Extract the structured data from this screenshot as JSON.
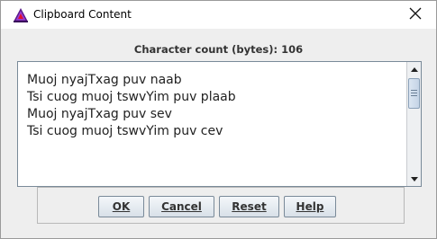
{
  "window": {
    "title": "Clipboard Content"
  },
  "header": {
    "count_label": "Character count (bytes): 106"
  },
  "content": {
    "lines": [
      "Muoj nyajTxag puv naab",
      "Tsi cuog muoj tswvYim puv plaab",
      "Muoj nyajTxag puv sev",
      "Tsi cuog muoj tswvYim puv cev"
    ]
  },
  "buttons": {
    "ok": "OK",
    "cancel": "Cancel",
    "reset": "Reset",
    "help": "Help"
  },
  "icons": {
    "app": "app-icon",
    "close": "close-icon",
    "scroll_up": "scroll-up-arrow-icon",
    "scroll_down": "scroll-down-arrow-icon"
  },
  "colors": {
    "button_border": "#7a8a99",
    "scroll_thumb": "#c4d4e6"
  }
}
